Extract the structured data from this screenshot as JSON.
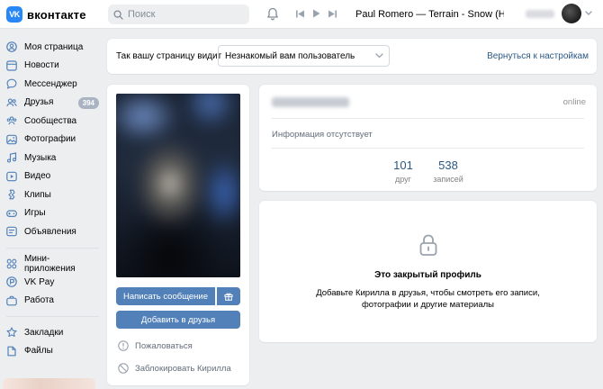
{
  "header": {
    "logo_letters": "VK",
    "logo_text": "вконтакте",
    "search_placeholder": "Поиск",
    "now_playing": "Paul Romero — Terrain - Snow (Heroe..."
  },
  "sidebar": {
    "items": [
      {
        "label": "Моя страница",
        "icon": "user-circle-icon"
      },
      {
        "label": "Новости",
        "icon": "newspaper-icon"
      },
      {
        "label": "Мессенджер",
        "icon": "chat-bubble-icon"
      },
      {
        "label": "Друзья",
        "icon": "friends-icon",
        "badge": "394"
      },
      {
        "label": "Сообщества",
        "icon": "communities-icon"
      },
      {
        "label": "Фотографии",
        "icon": "photo-icon"
      },
      {
        "label": "Музыка",
        "icon": "music-note-icon"
      },
      {
        "label": "Видео",
        "icon": "video-icon"
      },
      {
        "label": "Клипы",
        "icon": "clips-icon"
      },
      {
        "label": "Игры",
        "icon": "gamepad-icon"
      },
      {
        "label": "Объявления",
        "icon": "ads-icon"
      }
    ],
    "items2": [
      {
        "label": "Мини-приложения",
        "icon": "apps-icon"
      },
      {
        "label": "VK Pay",
        "icon": "vkpay-icon"
      },
      {
        "label": "Работа",
        "icon": "briefcase-icon"
      }
    ],
    "items3": [
      {
        "label": "Закладки",
        "icon": "star-icon"
      },
      {
        "label": "Файлы",
        "icon": "file-icon"
      }
    ]
  },
  "view_bar": {
    "label": "Так вашу страницу видит",
    "selected": "Незнакомый вам пользователь",
    "back_link": "Вернуться к настройкам"
  },
  "profile": {
    "write_message": "Написать сообщение",
    "add_friend": "Добавить в друзья",
    "report": "Пожаловаться",
    "block": "Заблокировать Кирилла"
  },
  "info": {
    "status": "online",
    "no_info": "Информация отсутствует",
    "counters": [
      {
        "num": "101",
        "cap": "друг"
      },
      {
        "num": "538",
        "cap": "записей"
      }
    ]
  },
  "closed": {
    "title": "Это закрытый профиль",
    "text": "Добавьте Кирилла в друзья, чтобы смотреть его записи, фотографии и другие материалы"
  },
  "colors": {
    "accent": "#5181b8",
    "link": "#2a5885",
    "logo": "#2787f5",
    "page_bg": "#edeef0"
  }
}
